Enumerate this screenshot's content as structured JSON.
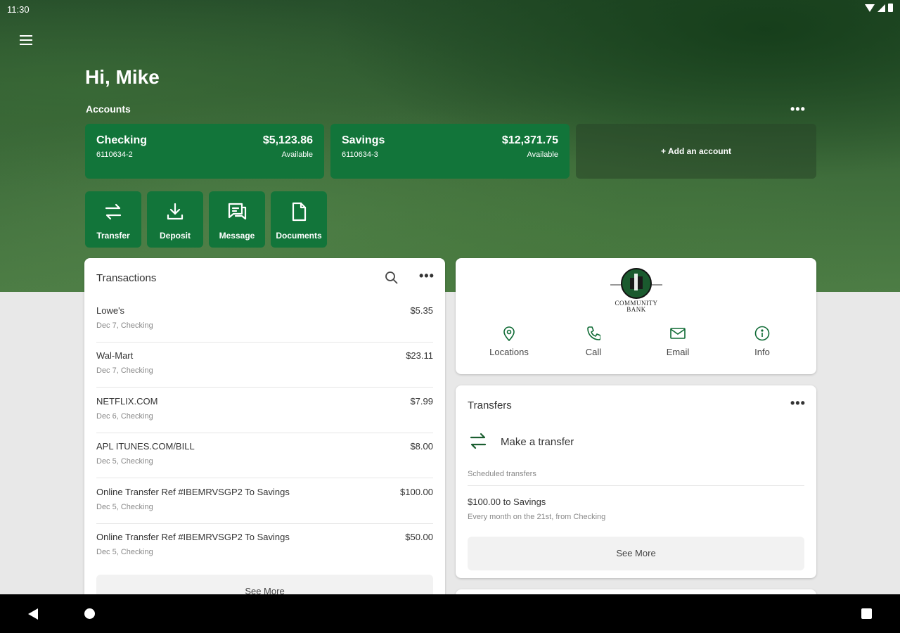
{
  "status_bar": {
    "time": "11:30"
  },
  "header": {
    "greeting": "Hi, Mike",
    "accounts_label": "Accounts",
    "more_label": "•••"
  },
  "accounts": [
    {
      "name": "Checking",
      "number": "6110634-2",
      "balance": "$5,123.86",
      "balance_label": "Available"
    },
    {
      "name": "Savings",
      "number": "6110634-3",
      "balance": "$12,371.75",
      "balance_label": "Available"
    }
  ],
  "add_account_label": "+ Add an account",
  "quick_actions": [
    {
      "label": "Transfer",
      "icon": "transfer-icon"
    },
    {
      "label": "Deposit",
      "icon": "deposit-icon"
    },
    {
      "label": "Message",
      "icon": "message-icon"
    },
    {
      "label": "Documents",
      "icon": "documents-icon"
    }
  ],
  "transactions": {
    "title": "Transactions",
    "more_label": "•••",
    "items": [
      {
        "name": "Lowe's",
        "sub": "Dec 7, Checking",
        "amount": "$5.35"
      },
      {
        "name": "Wal-Mart",
        "sub": "Dec 7, Checking",
        "amount": "$23.11"
      },
      {
        "name": "NETFLIX.COM",
        "sub": "Dec 6, Checking",
        "amount": "$7.99"
      },
      {
        "name": "APL ITUNES.COM/BILL",
        "sub": "Dec 5, Checking",
        "amount": "$8.00"
      },
      {
        "name": "Online Transfer Ref #IBEMRVSGP2 To Savings",
        "sub": "Dec 5, Checking",
        "amount": "$100.00"
      },
      {
        "name": "Online Transfer Ref #IBEMRVSGP2 To Savings",
        "sub": "Dec 5, Checking",
        "amount": "$50.00"
      }
    ],
    "see_more_label": "See More"
  },
  "bank": {
    "logo_text_line1": "COMMUNITY",
    "logo_text_line2": "BANK",
    "actions": [
      {
        "label": "Locations",
        "icon": "location-pin-icon"
      },
      {
        "label": "Call",
        "icon": "phone-icon"
      },
      {
        "label": "Email",
        "icon": "email-icon"
      },
      {
        "label": "Info",
        "icon": "info-icon"
      }
    ]
  },
  "transfers": {
    "title": "Transfers",
    "more_label": "•••",
    "make_transfer_label": "Make a transfer",
    "scheduled_label": "Scheduled transfers",
    "scheduled_item_title": "$100.00 to Savings",
    "scheduled_item_sub": "Every month on the 21st, from Checking",
    "see_more_label": "See More"
  },
  "colors": {
    "brand_green": "#12753a",
    "background": "#e8e8e8"
  }
}
